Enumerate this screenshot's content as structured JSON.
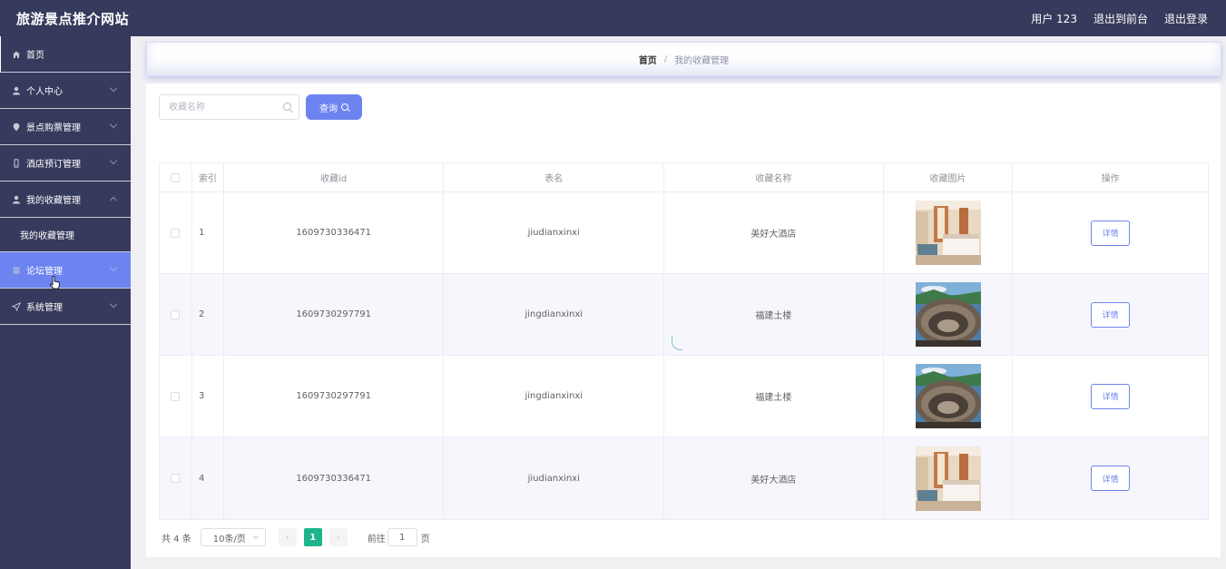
{
  "header": {
    "title": "旅游景点推介网站",
    "user": "用户 123",
    "back_front": "退出到前台",
    "logout": "退出登录"
  },
  "sidebar": {
    "items": [
      {
        "label": "首页",
        "icon": "home-icon"
      },
      {
        "label": "个人中心",
        "icon": "user-icon"
      },
      {
        "label": "景点购票管理",
        "icon": "location-icon"
      },
      {
        "label": "酒店预订管理",
        "icon": "phone-icon"
      },
      {
        "label": "我的收藏管理",
        "icon": "user-icon"
      },
      {
        "label": "我的收藏管理"
      },
      {
        "label": "论坛管理",
        "icon": "document-icon"
      },
      {
        "label": "系统管理",
        "icon": "send-icon"
      }
    ]
  },
  "breadcrumb": {
    "home": "首页",
    "separator": "/",
    "current": "我的收藏管理"
  },
  "search": {
    "placeholder": "收藏名称",
    "button": "查询"
  },
  "table": {
    "columns": [
      "索引",
      "收藏id",
      "表名",
      "收藏名称",
      "收藏图片",
      "操作"
    ],
    "rows": [
      {
        "index": "1",
        "id": "1609730336471",
        "table_name": "jiudianxinxi",
        "name": "美好大酒店",
        "image": "hotel-room"
      },
      {
        "index": "2",
        "id": "1609730297791",
        "table_name": "jingdianxinxi",
        "name": "福建土楼",
        "image": "tulou"
      },
      {
        "index": "3",
        "id": "1609730297791",
        "table_name": "jingdianxinxi",
        "name": "福建土楼",
        "image": "tulou"
      },
      {
        "index": "4",
        "id": "1609730336471",
        "table_name": "jiudianxinxi",
        "name": "美好大酒店",
        "image": "hotel-room"
      }
    ],
    "detail_label": "详情"
  },
  "pagination": {
    "total": "共 4 条",
    "page_size": "10条/页",
    "prev": "‹",
    "current_page": "1",
    "next": "›",
    "goto_label": "前往",
    "goto_value": "1",
    "page_suffix": "页"
  },
  "colors": {
    "header_bg": "#363a5c",
    "accent": "#6d84f0",
    "pager_active": "#1fb48a"
  }
}
